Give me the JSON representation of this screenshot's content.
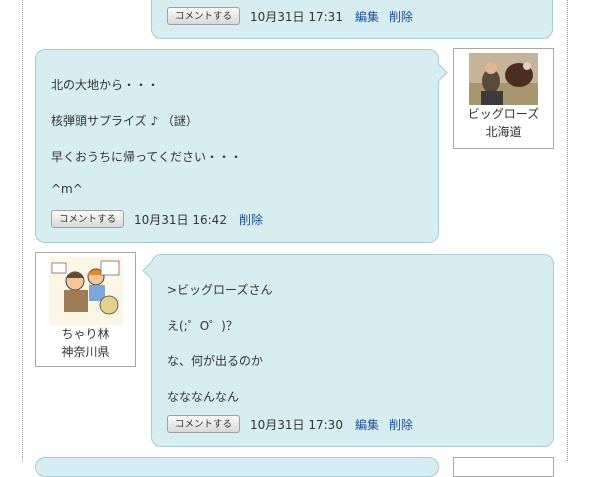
{
  "comments": [
    {
      "id": "top-reply",
      "lines": [],
      "action": "コメントする",
      "date": "10月31日 17:31",
      "edit": "編集",
      "delete": "削除"
    },
    {
      "id": "bigrose-comment",
      "lines": [
        "北の大地から・・・",
        "核弾頭サプライズ ♪ （謎）",
        "早くおうちに帰ってください・・・",
        "^m^"
      ],
      "action": "コメントする",
      "date": "10月31日 16:42",
      "delete": "削除"
    },
    {
      "id": "chari-reply",
      "lines": [
        ">ビッグローズさん",
        "え(;゜O゜)？",
        "な、何が出るのか",
        "なななんなん"
      ],
      "action": "コメントする",
      "date": "10月31日 17:30",
      "edit": "編集",
      "delete": "削除"
    }
  ],
  "profiles": {
    "bigrose": {
      "name": "ビッグローズ",
      "location": "北海道"
    },
    "chari": {
      "name": "ちゃり林",
      "location": "神奈川県"
    }
  },
  "colors": {
    "bubble": "#d6eef2",
    "bubble_border": "#a9cbd2",
    "link": "#1a4f98"
  }
}
